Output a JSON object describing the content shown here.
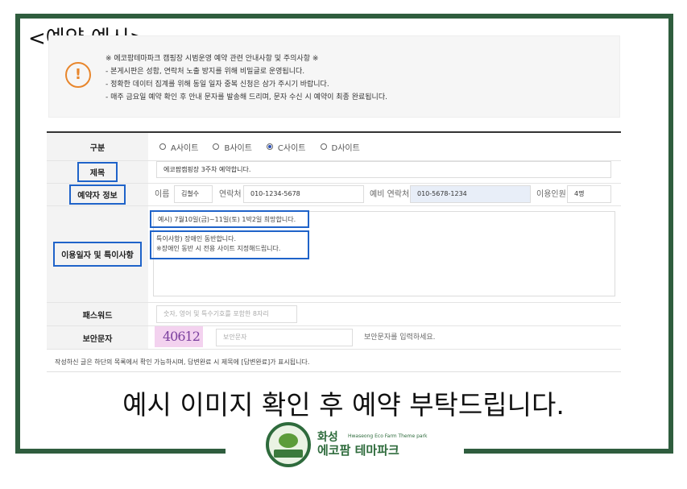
{
  "title": "<예약 예시>",
  "notice": {
    "icon": "exclamation-icon",
    "lines": [
      "※ 에코팜테마파크 캠핑장 시범운영 예약 관련 안내사항 및 주의사항 ※",
      "- 본게시판은 성함, 연락처 노출 방지를 위해 비밀글로 운영됩니다.",
      "- 정확한 데이터 집계를 위해 동일 일자 중복 신청은 삼가 주시기 바랍니다.",
      "- 매주 금요일 예약 확인 후 안내 문자를 발송해 드리며, 문자 수신 시 예약이 최종 완료됩니다."
    ]
  },
  "form": {
    "category": {
      "label": "구분",
      "options": [
        "A사이트",
        "B사이트",
        "C사이트",
        "D사이트"
      ],
      "selected": "C사이트"
    },
    "subject": {
      "label": "제목",
      "value": "에코팜캠핑장 3주차 예약합니다."
    },
    "reserver": {
      "label": "예약자 정보",
      "name_label": "이름",
      "name_value": "김철수",
      "phone_label": "연락처",
      "phone_value": "010-1234-5678",
      "alt_phone_label": "예비 연락처",
      "alt_phone_value": "010-5678-1234",
      "people_label": "이용인원",
      "people_value": "4명"
    },
    "usage": {
      "label": "이용일자 및 특이사항",
      "line1": "예시) 7월10일(금)~11일(토) 1박2일 희망합니다.",
      "line2": "특이사항) 장애인 동반합니다.",
      "line3": "※장애인 동반 시 전용 사이트 지정해드립니다."
    },
    "password": {
      "label": "패스워드",
      "placeholder": "숫자, 영어 및 특수기호를 포함한 8자리"
    },
    "captcha": {
      "label": "보안문자",
      "image_text": "40612",
      "placeholder": "보안문자",
      "hint": "보안문자를 입력하세요."
    }
  },
  "footer_note": "작성하신 글은 하단의 목록에서 확인 가능하시며, 답변완료 시 제목에 [답변완료]가 표시됩니다.",
  "caption": "예시 이미지 확인 후 예약 부탁드립니다.",
  "logo": {
    "name_small": "화성",
    "name_en": "Hwaseong Eco Farm Theme park",
    "name_big": "에코팜 테마파크"
  },
  "colors": {
    "frame": "#2f5d3e",
    "highlight": "#1f63c9",
    "notice_icon": "#e8862c",
    "captcha_bg": "#f3d2ef"
  }
}
